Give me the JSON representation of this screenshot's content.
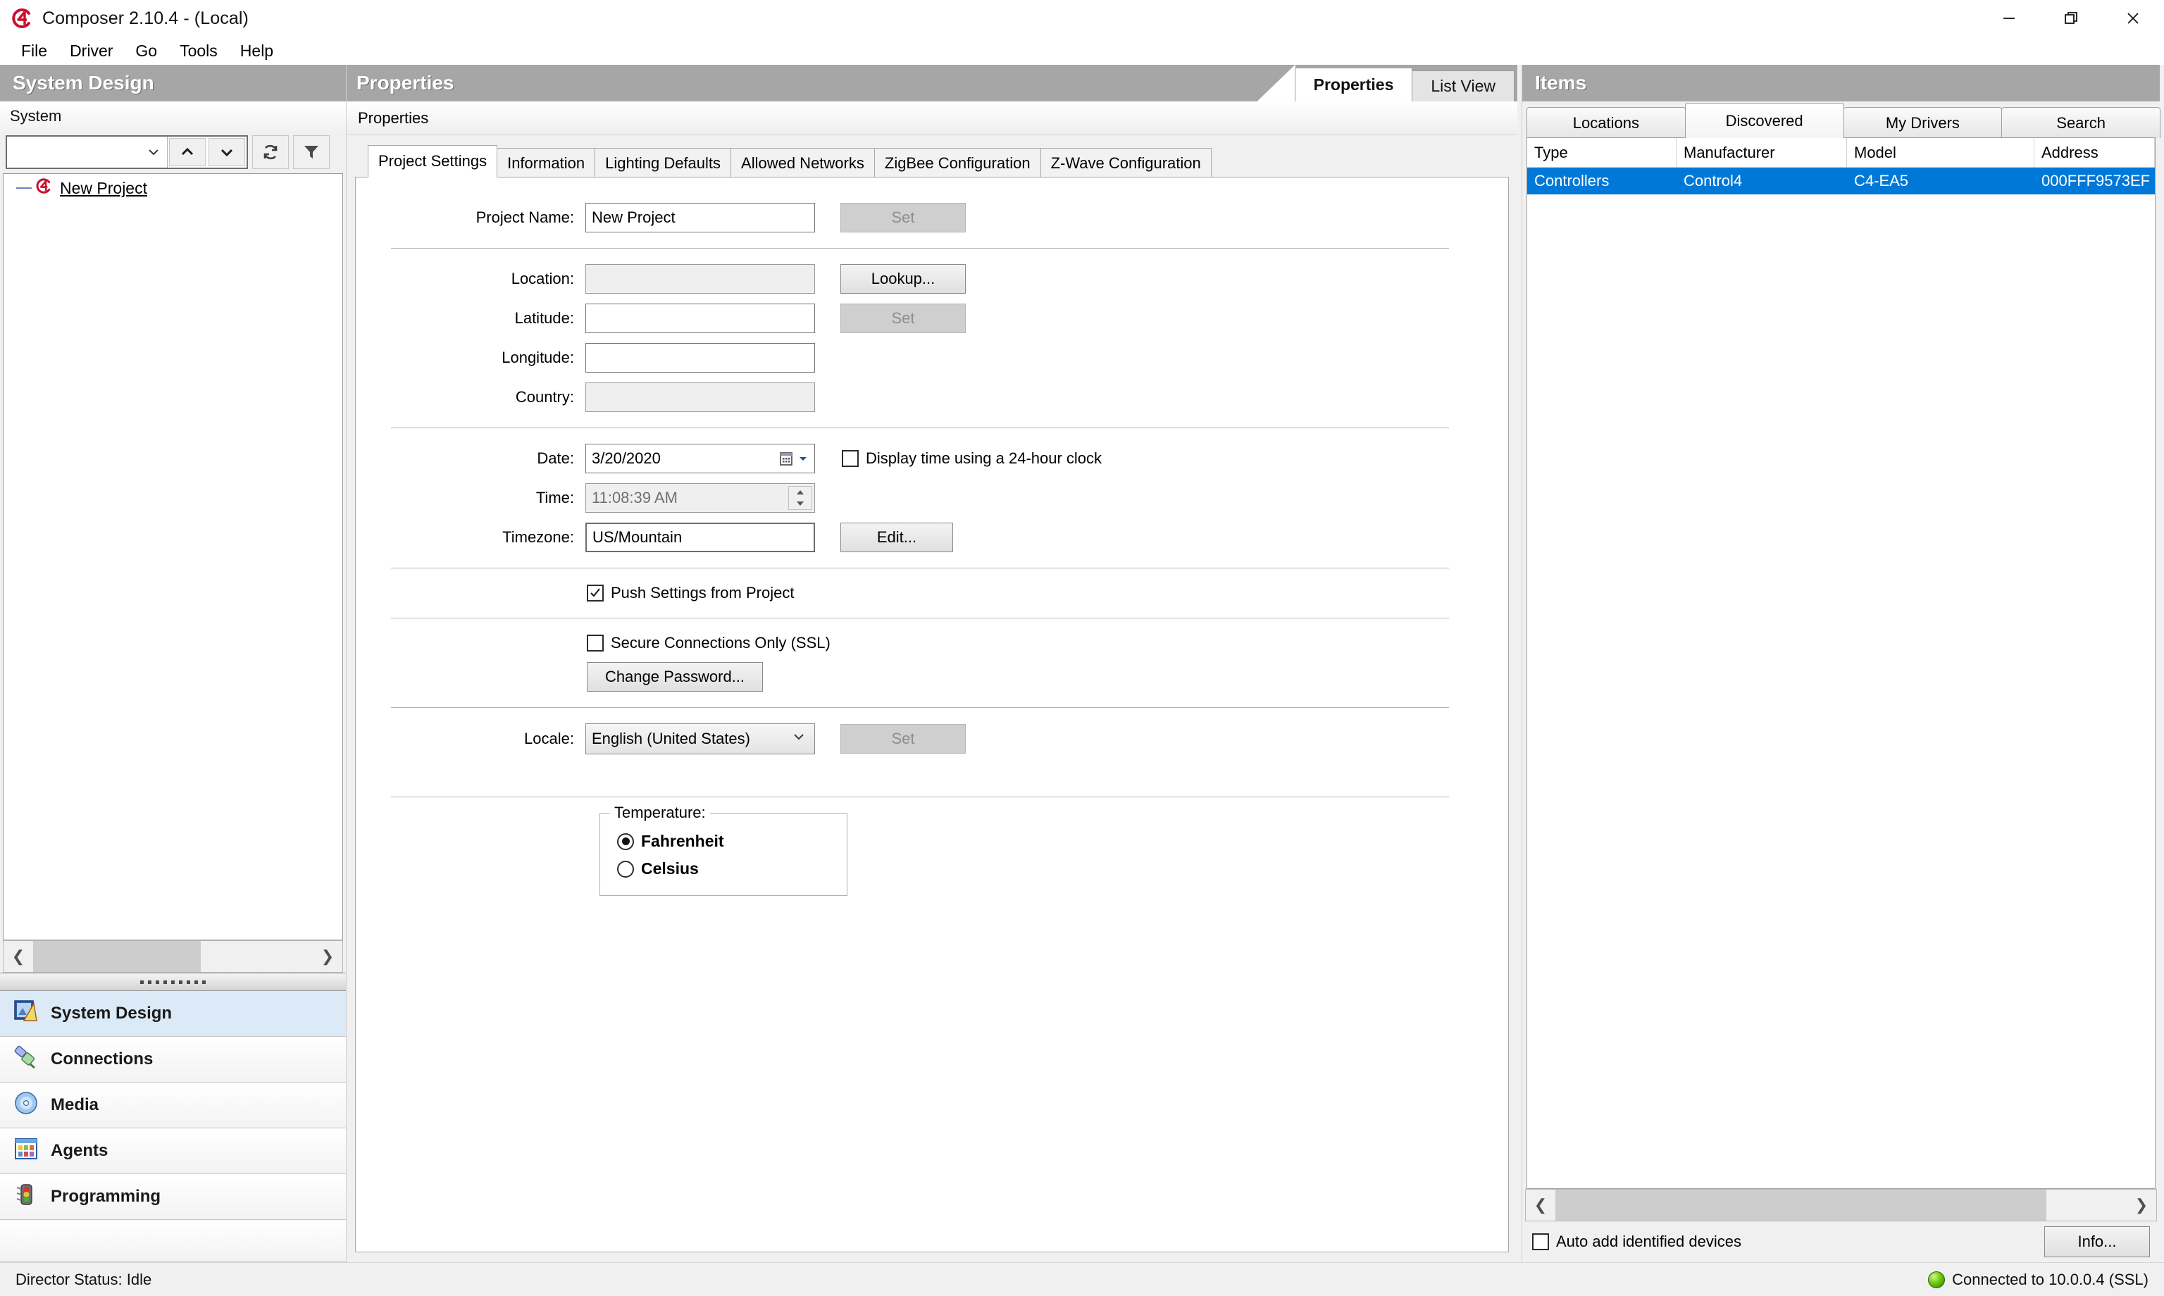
{
  "window": {
    "title": "Composer 2.10.4 - (Local)",
    "logo_icon": "control4-logo-icon",
    "controls": [
      {
        "name": "minimize",
        "glyph": "—"
      },
      {
        "name": "restore",
        "glyph": "restore-icon"
      },
      {
        "name": "close",
        "glyph": "✕"
      }
    ]
  },
  "menubar": {
    "items": [
      "File",
      "Driver",
      "Go",
      "Tools",
      "Help"
    ]
  },
  "left_panel": {
    "caption": "System Design",
    "subcaption": "System",
    "toolbar": {
      "combo_value": "",
      "up_icon": "chevron-up-icon",
      "down_icon": "chevron-down-icon",
      "refresh_icon": "refresh-icon",
      "filter_icon": "funnel-filter-icon"
    },
    "tree": [
      {
        "label": "New Project",
        "icon": "control4-project-icon"
      }
    ],
    "nav_items": [
      {
        "label": "System Design",
        "icon": "system-design-icon",
        "active": true
      },
      {
        "label": "Connections",
        "icon": "connections-plug-icon",
        "active": false
      },
      {
        "label": "Media",
        "icon": "media-disc-icon",
        "active": false
      },
      {
        "label": "Agents",
        "icon": "agents-grid-icon",
        "active": false
      },
      {
        "label": "Programming",
        "icon": "programming-trafficlight-icon",
        "active": false
      }
    ]
  },
  "center_panel": {
    "caption": "Properties",
    "subcaption": "Properties",
    "view_tabs": [
      {
        "label": "Properties",
        "active": true
      },
      {
        "label": "List View",
        "active": false
      }
    ],
    "tabs": [
      {
        "label": "Project Settings",
        "active": true
      },
      {
        "label": "Information",
        "active": false
      },
      {
        "label": "Lighting Defaults",
        "active": false
      },
      {
        "label": "Allowed Networks",
        "active": false
      },
      {
        "label": "ZigBee Configuration",
        "active": false
      },
      {
        "label": "Z-Wave Configuration",
        "active": false
      }
    ],
    "form": {
      "project_name_label": "Project Name:",
      "project_name_value": "New Project",
      "project_name_set": "Set",
      "location_label": "Location:",
      "location_value": "",
      "lookup_button": "Lookup...",
      "latitude_label": "Latitude:",
      "latitude_value": "",
      "latitude_set": "Set",
      "longitude_label": "Longitude:",
      "longitude_value": "",
      "country_label": "Country:",
      "country_value": "",
      "date_label": "Date:",
      "date_value": "3/20/2020",
      "clock24_label": "Display time using a 24-hour clock",
      "clock24_checked": false,
      "time_label": "Time:",
      "time_value": "11:08:39 AM",
      "timezone_label": "Timezone:",
      "timezone_value": "US/Mountain",
      "timezone_edit": "Edit...",
      "push_settings_label": "Push Settings from Project",
      "push_settings_checked": true,
      "ssl_label": "Secure Connections Only (SSL)",
      "ssl_checked": false,
      "change_password_button": "Change Password...",
      "locale_label": "Locale:",
      "locale_value": "English (United States)",
      "locale_set": "Set",
      "temperature_legend": "Temperature:",
      "temperature_options": [
        {
          "label": "Fahrenheit",
          "selected": true
        },
        {
          "label": "Celsius",
          "selected": false
        }
      ]
    }
  },
  "right_panel": {
    "caption": "Items",
    "tabs": [
      {
        "label": "Locations",
        "active": false
      },
      {
        "label": "Discovered",
        "active": true
      },
      {
        "label": "My Drivers",
        "active": false
      },
      {
        "label": "Search",
        "active": false
      }
    ],
    "columns": [
      "Type",
      "Manufacturer",
      "Model",
      "Address"
    ],
    "rows": [
      {
        "type": "Controllers",
        "manufacturer": "Control4",
        "model": "C4-EA5",
        "address": "000FFF9573EF",
        "selected": true
      }
    ],
    "auto_add_label": "Auto add identified devices",
    "auto_add_checked": false,
    "info_button": "Info..."
  },
  "statusbar": {
    "left": "Director Status: Idle",
    "right": "Connected to 10.0.0.4 (SSL)",
    "status_icon": "green-status-dot"
  },
  "colors": {
    "caption_bg": "#a6a6a6",
    "selection_blue": "#0078d7",
    "nav_active": "#dceaf7",
    "accent_red": "#c8102e"
  }
}
